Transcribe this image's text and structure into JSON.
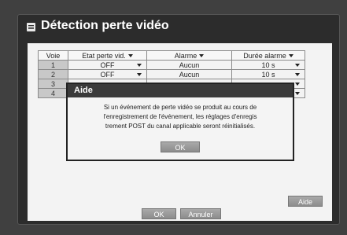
{
  "window": {
    "title": "Détection perte vidéo"
  },
  "table": {
    "headers": [
      "Voie",
      "Etat perte vid.",
      "Alarme",
      "Durée alarme"
    ],
    "rows": [
      {
        "num": "1",
        "etat": "OFF",
        "alarme": "Aucun",
        "duree": "10 s"
      },
      {
        "num": "2",
        "etat": "OFF",
        "alarme": "Aucun",
        "duree": "10 s"
      },
      {
        "num": "3",
        "etat": "",
        "alarme": "",
        "duree": ""
      },
      {
        "num": "4",
        "etat": "",
        "alarme": "",
        "duree": ""
      }
    ]
  },
  "dialog": {
    "title": "Aide",
    "message_line1": "Si un événement de perte vidéo se produit au cours de",
    "message_line2": "l'enregistrement de l'événement, les réglages d'enregis",
    "message_line3": "trement POST du canal applicable seront réinitialisés.",
    "ok_label": "OK"
  },
  "panel": {
    "help_label": "Aide"
  },
  "footer": {
    "ok_label": "OK",
    "cancel_label": "Annuler"
  },
  "colors": {
    "background": "#404040",
    "window": "#2c2c2c",
    "panel": "#f3f3f3",
    "button": "#9a9a9a",
    "dialog_header": "#3a3a3a"
  }
}
